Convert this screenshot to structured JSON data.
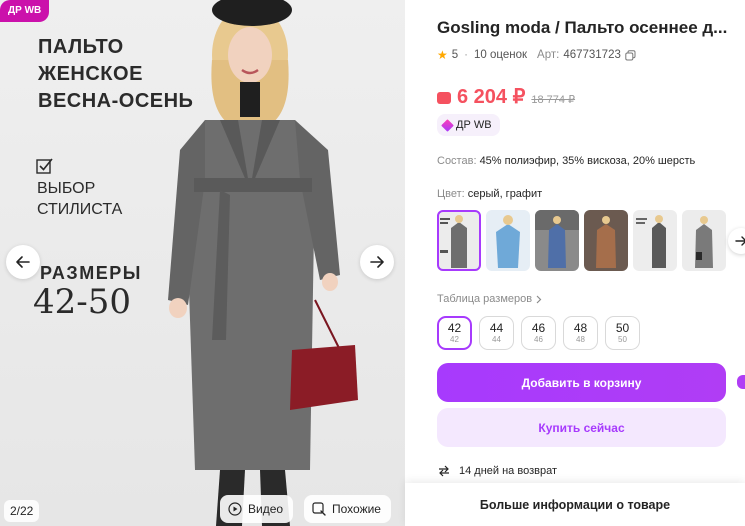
{
  "gallery": {
    "promo_badge": "ДР WB",
    "promo_title": "ПАЛЬТО ЖЕНСКОЕ ВЕСНА-ОСЕНЬ",
    "promo_stylist": "ВЫБОР СТИЛИСТА",
    "promo_sizes_label": "РАЗМЕРЫ",
    "promo_sizes_value": "42-50",
    "counter": "2/22",
    "video_label": "Видео",
    "similar_label": "Похожие"
  },
  "product": {
    "title": "Gosling moda / Пальто осеннее д...",
    "rating": "5",
    "reviews": "10 оценок",
    "article_label": "Арт:",
    "article": "467731723",
    "price": "6 204 ₽",
    "old_price": "18 774 ₽",
    "dr_badge": "ДР WB",
    "composition_label": "Состав:",
    "composition_value": "45% полиэфир, 35% вискоза, 20% шерсть",
    "color_label": "Цвет:",
    "color_value": "серый, графит",
    "size_table_label": "Таблица размеров",
    "sizes": [
      {
        "main": "42",
        "sub": "42"
      },
      {
        "main": "44",
        "sub": "44"
      },
      {
        "main": "46",
        "sub": "46"
      },
      {
        "main": "48",
        "sub": "48"
      },
      {
        "main": "50",
        "sub": "50"
      }
    ],
    "add_to_cart": "Добавить в корзину",
    "buy_now": "Купить сейчас",
    "returns": "14 дней на возврат",
    "more_info": "Больше информации о товаре"
  },
  "colors": {
    "accent": "#a73afd",
    "price": "#f5515f",
    "promo": "#cb11ab"
  },
  "icons": [
    "arrow-left-icon",
    "arrow-right-icon",
    "play-icon",
    "search-icon",
    "star-icon",
    "copy-icon",
    "wallet-icon",
    "diamond-icon",
    "check-box-icon",
    "chevron-right-icon",
    "return-icon",
    "heart-icon"
  ]
}
